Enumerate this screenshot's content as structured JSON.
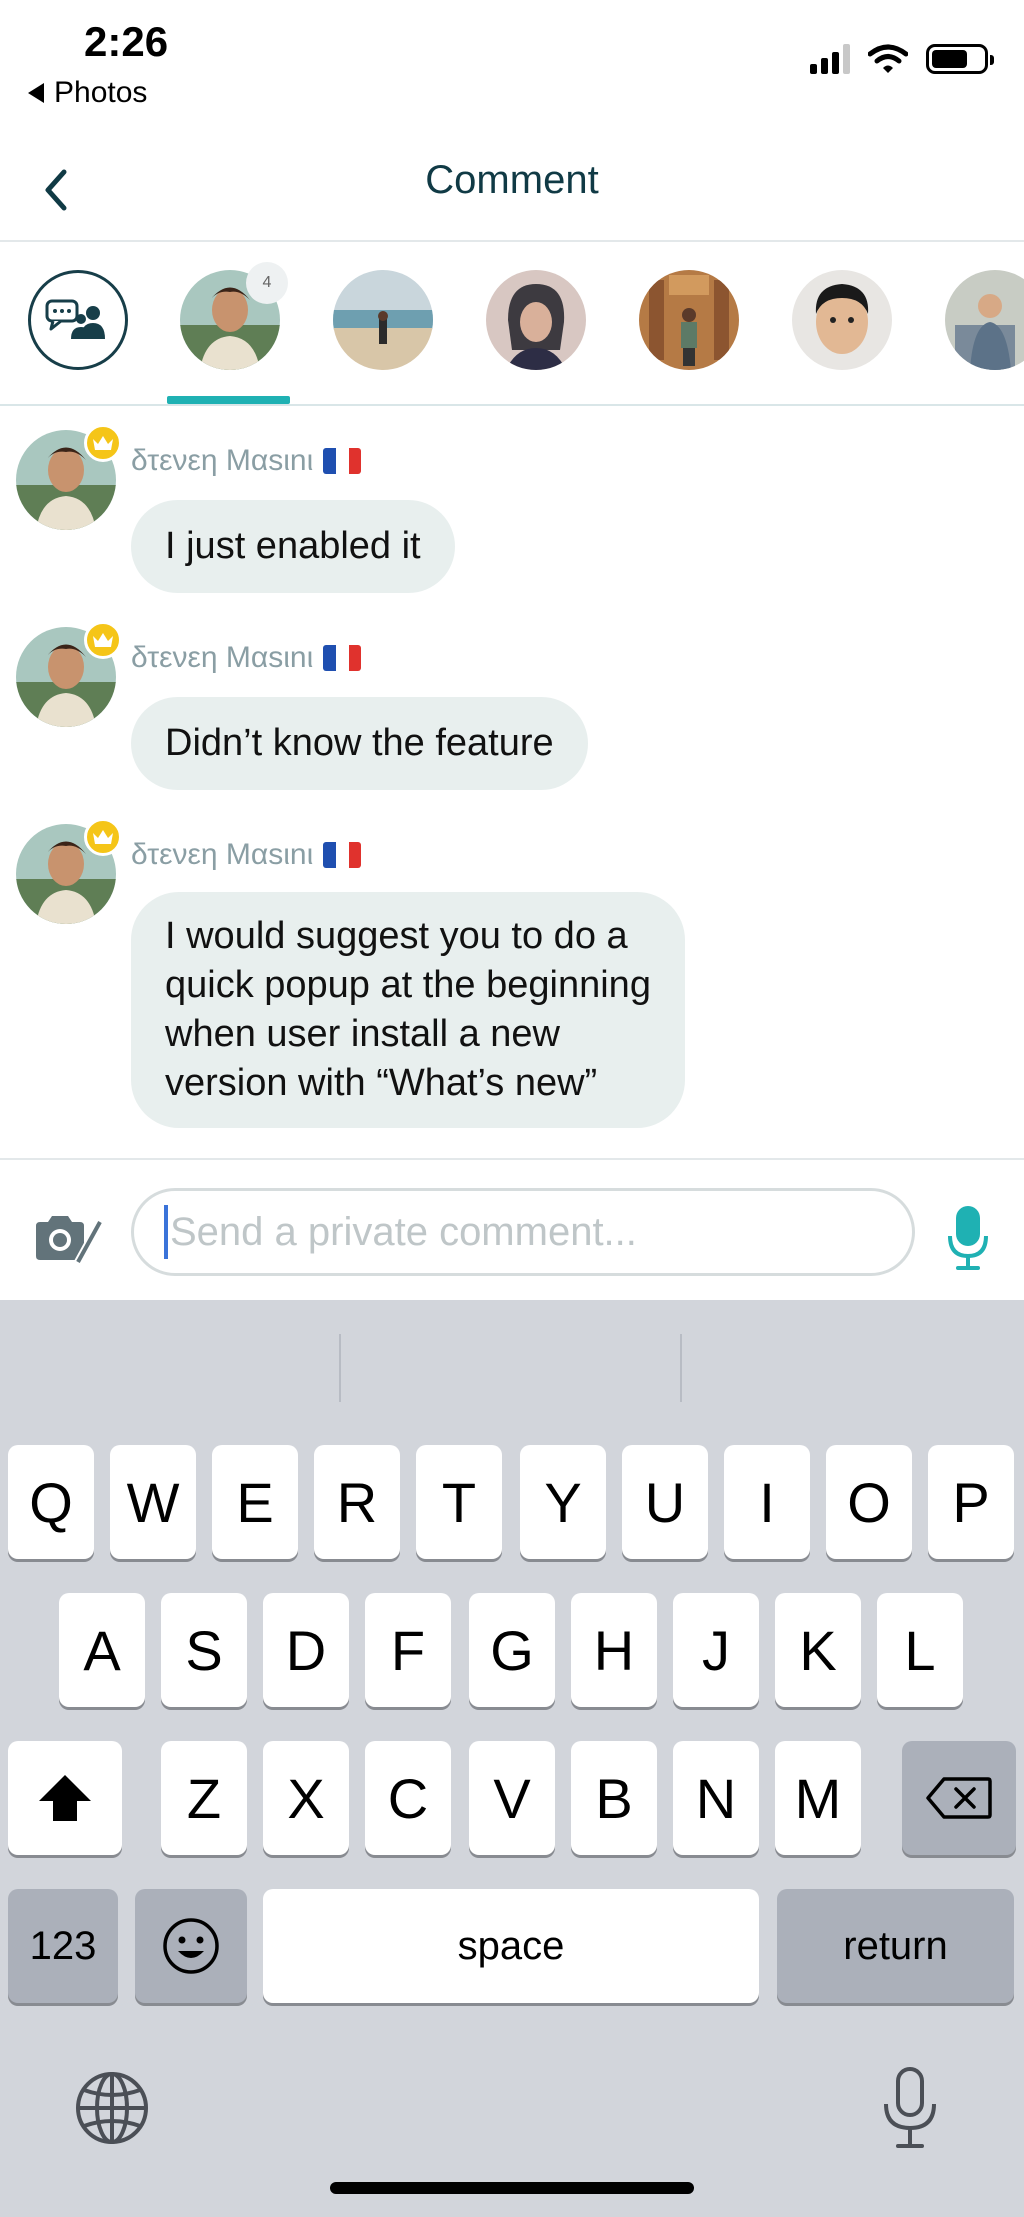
{
  "status_bar": {
    "time": "2:26",
    "back_app": "Photos"
  },
  "nav": {
    "title": "Comment"
  },
  "avatar_strip": {
    "unread_count": "4",
    "accent_color": "#1fb1b3"
  },
  "messages": [
    {
      "sender": "δτενεη Μαsιnι",
      "text": "I just enabled it"
    },
    {
      "sender": "δτενεη Μαsιnι",
      "text": "Didn’t know the feature"
    },
    {
      "sender": "δτενεη Μαsιnι",
      "text_lines": [
        "I would suggest you to do a",
        "quick popup at the beginning",
        "when user install a new",
        "version with “What’s new”"
      ]
    }
  ],
  "composer": {
    "placeholder": "Send a private comment..."
  },
  "keyboard": {
    "row1": [
      "Q",
      "W",
      "E",
      "R",
      "T",
      "Y",
      "U",
      "I",
      "O",
      "P"
    ],
    "row2": [
      "A",
      "S",
      "D",
      "F",
      "G",
      "H",
      "J",
      "K",
      "L"
    ],
    "row3": [
      "Z",
      "X",
      "C",
      "V",
      "B",
      "N",
      "M"
    ],
    "numbers_key": "123",
    "space_key": "space",
    "return_key": "return"
  }
}
